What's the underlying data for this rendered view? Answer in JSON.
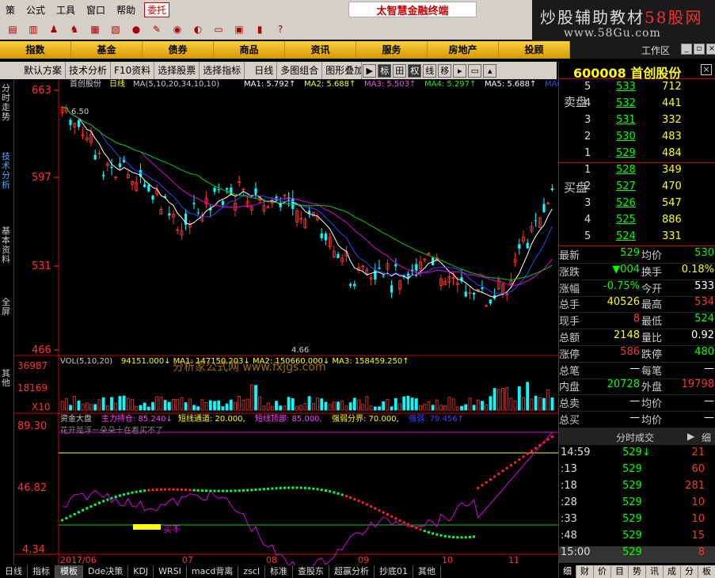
{
  "menu": {
    "items": [
      "策",
      "公式",
      "工具",
      "窗口",
      "帮助"
    ],
    "entrust": "委托",
    "brand": "太智慧金融终端"
  },
  "logo": {
    "part1": "炒股辅助教材",
    "part2": "58股网",
    "url": "www.58Gu.com"
  },
  "categories": [
    "指数",
    "基金",
    "债券",
    "商品",
    "资讯",
    "服务",
    "房地产",
    "投顾"
  ],
  "window_controls": {
    "title": "工作区"
  },
  "tabs": [
    "默认方案",
    "技术分析",
    "F10资料",
    "选择股票",
    "选择指标",
    "日线",
    "多图组合",
    "图形叠加"
  ],
  "tab_icons": [
    "标",
    "田",
    "权",
    "线",
    "移"
  ],
  "left_bar": [
    "分时走势",
    "技术分析",
    "基本资料",
    "全屏",
    "其他"
  ],
  "price_chart": {
    "header_name": "首创股份",
    "header_period": "日线",
    "ma_params": "MA(5,10,20,34,10,10)",
    "ma_values": [
      {
        "label": "MA1:",
        "value": "5.792↑",
        "color": "#ffffff"
      },
      {
        "label": "MA2:",
        "value": "5.688↑",
        "color": "#ffff00"
      },
      {
        "label": "MA3:",
        "value": "5.503↑",
        "color": "#ff44ff"
      },
      {
        "label": "MA4:",
        "value": "5.297↑",
        "color": "#00ff00"
      },
      {
        "label": "MA5:",
        "value": "5.688↑",
        "color": "#ffffff"
      },
      {
        "label": "MA6:",
        "value": "",
        "color": "#4444ff"
      }
    ],
    "y_ticks": [
      "663",
      "597",
      "531",
      "466"
    ],
    "high_label": "6.50",
    "low_label": "4.66"
  },
  "volume_chart": {
    "header": "VOL(5,10,20)",
    "values_text": "94151.000↓ MA1: 147150.203↓ MA2: 150660.000↓ MA3: 158459.250↑",
    "y_ticks": [
      "36987",
      "18169",
      "X10"
    ],
    "watermark": "分析家公式网 www.fxjgs.com"
  },
  "indicator": {
    "title": "资金大盘",
    "items": [
      {
        "text": "主力持仓: 85.240↓",
        "color": "#ff44ff"
      },
      {
        "text": "短线通道: 20.000,",
        "color": "#ffff00"
      },
      {
        "text": "短线顶部: 85.000,",
        "color": "#ff44ff"
      },
      {
        "text": "强弱分界: 70.000,",
        "color": "#ffff00"
      },
      {
        "text": "强弱: 79.456↑",
        "color": "#4444ff"
      }
    ],
    "note": "花开是浮一朵朵十在看买不了",
    "y_ticks": [
      "89.30",
      "46.82",
      "4.34"
    ],
    "buy_label": "买不"
  },
  "x_axis": {
    "labels": [
      "2017/06",
      "07",
      "08",
      "09",
      "10",
      "11"
    ]
  },
  "bottom_tabs": [
    "日线",
    "指标",
    "模板",
    "Dde决策",
    "KDJ",
    "WRSI",
    "macd背离",
    "zscl",
    "标准",
    "查股东",
    "超赢分析",
    "抄底01",
    "其他"
  ],
  "right_panel": {
    "code": "600008",
    "name": "首创股份",
    "sell_label": "卖盘",
    "buy_label": "买盘",
    "sell_orders": [
      {
        "level": "5",
        "price": "533",
        "vol": "712"
      },
      {
        "level": "4",
        "price": "532",
        "vol": "441"
      },
      {
        "level": "3",
        "price": "531",
        "vol": "332"
      },
      {
        "level": "2",
        "price": "530",
        "vol": "483"
      },
      {
        "level": "1",
        "price": "529",
        "vol": "484"
      }
    ],
    "buy_orders": [
      {
        "level": "1",
        "price": "528",
        "vol": "349"
      },
      {
        "level": "2",
        "price": "527",
        "vol": "470"
      },
      {
        "level": "3",
        "price": "526",
        "vol": "547"
      },
      {
        "level": "4",
        "price": "525",
        "vol": "886"
      },
      {
        "level": "5",
        "price": "524",
        "vol": "331"
      }
    ],
    "stats": [
      {
        "k1": "最新",
        "v1": "529",
        "c1": "#00ff00",
        "k2": "均价",
        "v2": "530",
        "c2": "#00ff00"
      },
      {
        "k1": "涨跌",
        "v1": "▼004",
        "c1": "#00ff00",
        "k2": "换手",
        "v2": "0.18%",
        "c2": "#ffff00"
      },
      {
        "k1": "涨幅",
        "v1": "-0.75%",
        "c1": "#00ff00",
        "k2": "今开",
        "v2": "533",
        "c2": "#ffffff"
      },
      {
        "k1": "总手",
        "v1": "40526",
        "c1": "#ffff00",
        "k2": "最高",
        "v2": "534",
        "c2": "#ff3333"
      },
      {
        "k1": "现手",
        "v1": "8",
        "c1": "#ff3333",
        "k2": "最低",
        "v2": "524",
        "c2": "#00ff00"
      },
      {
        "k1": "总额",
        "v1": "2148",
        "c1": "#ffff00",
        "k2": "量比",
        "v2": "0.92",
        "c2": "#ffffff"
      },
      {
        "k1": "涨停",
        "v1": "586",
        "c1": "#ff3333",
        "k2": "跌停",
        "v2": "480",
        "c2": "#00ff00"
      },
      {
        "k1": "总笔",
        "v1": "—",
        "c1": "#ffffff",
        "k2": "每笔",
        "v2": "—",
        "c2": "#ffffff"
      },
      {
        "k1": "内盘",
        "v1": "20728",
        "c1": "#00ff00",
        "k2": "外盘",
        "v2": "19798",
        "c2": "#ff3333"
      },
      {
        "k1": "总卖",
        "v1": "—",
        "c1": "#ffffff",
        "k2": "均价",
        "v2": "—",
        "c2": "#ffffff"
      },
      {
        "k1": "总买",
        "v1": "—",
        "c1": "#ffffff",
        "k2": "均价",
        "v2": "—",
        "c2": "#ffffff"
      }
    ],
    "ticks_header": "分时成交",
    "ticks_btn": "细",
    "ticks": [
      {
        "time": "14:59",
        "price": "529↓",
        "vol": "21"
      },
      {
        "time": ":13",
        "price": "529",
        "vol": "60"
      },
      {
        "time": ":18",
        "price": "529",
        "vol": "281"
      },
      {
        "time": ":28",
        "price": "529",
        "vol": "10"
      },
      {
        "time": ":33",
        "price": "529",
        "vol": "10"
      },
      {
        "time": ":48",
        "price": "529",
        "vol": "15"
      },
      {
        "time": "15:00",
        "price": "529",
        "vol": "8"
      }
    ],
    "bottom_btns": [
      "细",
      "财",
      "价",
      "目",
      "势",
      "讯",
      "成",
      "分",
      "板"
    ]
  }
}
